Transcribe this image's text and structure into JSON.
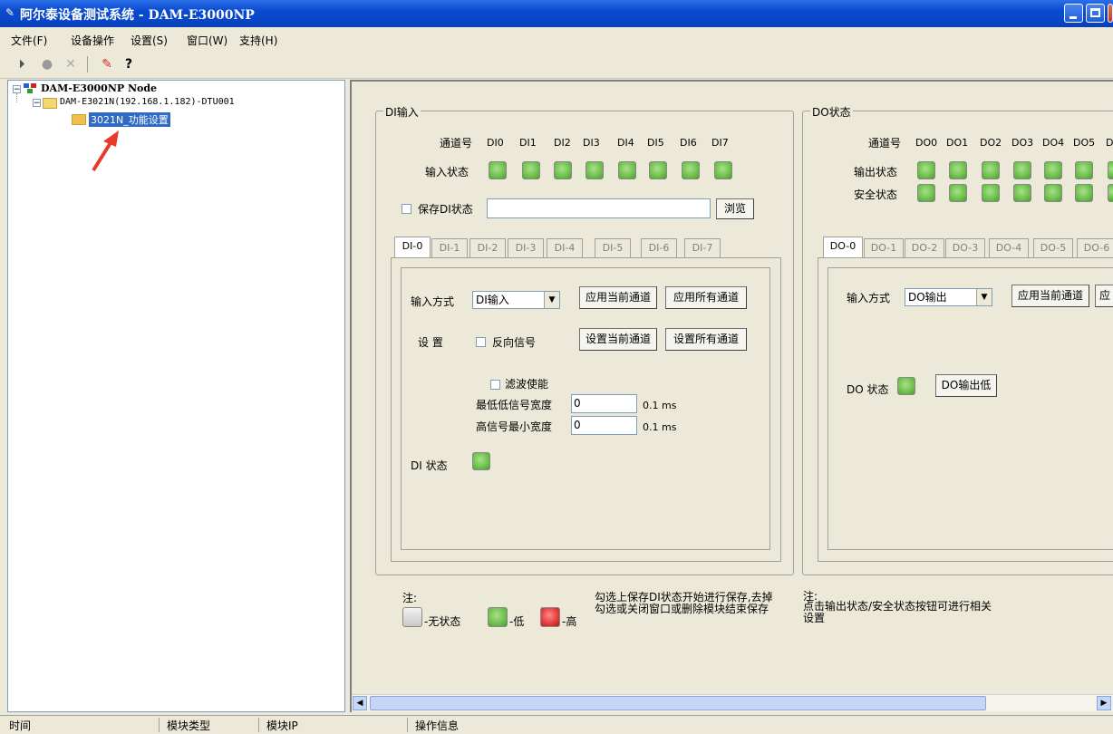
{
  "window": {
    "title": "阿尔泰设备测试系统 - DAM-E3000NP",
    "app_icon": "pencil-icon"
  },
  "menubar": {
    "items": [
      {
        "label": "文件(F)"
      },
      {
        "label": "设备操作"
      },
      {
        "label": "设置(S)"
      },
      {
        "label": "窗口(W)"
      },
      {
        "label": "支持(H)"
      }
    ]
  },
  "toolbar": {
    "icons": [
      "connect-icon",
      "disconnect-icon",
      "delete-icon",
      "pen-icon",
      "help-icon"
    ]
  },
  "tree": {
    "root": "DAM-E3000NP Node",
    "device": "DAM-E3021N(192.168.1.182)-DTU001",
    "selected": "3021N_功能设置"
  },
  "di_group": {
    "title": "DI输入",
    "channel_label": "通道号",
    "channels": [
      "DI0",
      "DI1",
      "DI2",
      "DI3",
      "DI4",
      "DI5",
      "DI6",
      "DI7"
    ],
    "input_state_label": "输入状态",
    "input_states": [
      "low",
      "low",
      "low",
      "low",
      "low",
      "low",
      "low",
      "low"
    ],
    "save_label": "保存DI状态",
    "save_path": "",
    "browse_label": "浏览",
    "tabs": [
      "DI-0",
      "DI-1",
      "DI-2",
      "DI-3",
      "DI-4",
      "DI-5",
      "DI-6",
      "DI-7"
    ],
    "active_tab": "DI-0",
    "input_mode_label": "输入方式",
    "input_mode_value": "DI输入",
    "apply_current": "应用当前通道",
    "apply_all": "应用所有通道",
    "setting_label": "设 置",
    "reverse_label": "反向信号",
    "set_current": "设置当前通道",
    "set_all": "设置所有通道",
    "filter_label": "滤波使能",
    "min_low_label": "最低低信号宽度",
    "min_low_value": "0",
    "min_high_label": "高信号最小宽度",
    "min_high_value": "0",
    "unit": "0.1 ms",
    "di_state_label": "DI 状态"
  },
  "do_group": {
    "title": "DO状态",
    "channel_label": "通道号",
    "channels": [
      "DO0",
      "DO1",
      "DO2",
      "DO3",
      "DO4",
      "DO5",
      "D"
    ],
    "output_state_label": "输出状态",
    "safe_state_label": "安全状态",
    "tabs": [
      "DO-0",
      "DO-1",
      "DO-2",
      "DO-3",
      "DO-4",
      "DO-5",
      "DO-6"
    ],
    "active_tab": "DO-0",
    "input_mode_label": "输入方式",
    "input_mode_value": "DO输出",
    "apply_current": "应用当前通道",
    "apply_all_partial": "应",
    "do_state_label": "DO 状态",
    "do_low_button": "DO输出低"
  },
  "notes": {
    "left_title": "注:",
    "legend_none": "-无状态",
    "legend_low": "-低",
    "legend_high": "-高",
    "save_hint": "勾选上保存DI状态开始进行保存,去掉勾选或关闭窗口或删除模块结束保存",
    "right_title": "注:",
    "right_hint": "点击输出状态/安全状态按钮可进行相关设置"
  },
  "statusbar": {
    "cells": [
      "时间",
      "模块类型",
      "模块IP",
      "操作信息"
    ]
  }
}
